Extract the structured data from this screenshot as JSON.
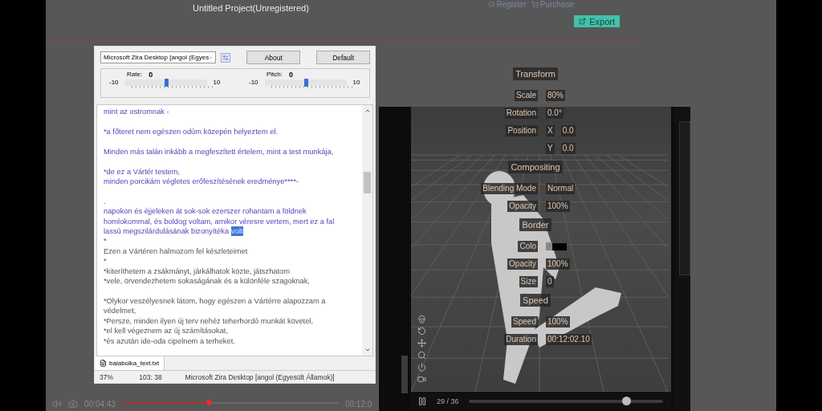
{
  "header": {
    "title": "Untitled Project(Unregistered)",
    "links": [
      {
        "kind": "register",
        "label": "Register"
      },
      {
        "kind": "purchase",
        "label": "Purchase"
      }
    ],
    "export_button": "Export"
  },
  "tts_window": {
    "voice": "Microsoft Zira Desktop [angol (Egyes",
    "buttons": [
      "About",
      "Default"
    ],
    "sliders": [
      {
        "label": "Rate:",
        "value": "0",
        "min": "-10",
        "max": "10",
        "level": 0.5
      },
      {
        "label": "Pitch:",
        "value": "0",
        "min": "-10",
        "max": "10",
        "level": 0.5
      }
    ],
    "paragraphs": [
      {
        "lines": [
          {
            "text": "mint az ostromnak -",
            "read": true
          }
        ]
      },
      {
        "lines": [
          {
            "text": "*a főteret nem egészen odúm közepén helyeztem el.",
            "read": true
          }
        ]
      },
      {
        "lines": [
          {
            "text": "Minden más talán inkább a megfeszített értelem, mint a test munkája,",
            "read": true
          }
        ]
      },
      {
        "lines": [
          {
            "text": "*de ez a Vártér testem,",
            "read": true
          },
          {
            "text": "minden porcikám végletes erőfeszítésének eredménye****-",
            "read": true
          }
        ]
      },
      {
        "lines": [
          {
            "text": "."
          },
          {
            "text": "napokon és éjjeleken át sok-sok ezerszer rohantam a földnek",
            "read": true
          },
          {
            "text": "homlokommal, és boldog voltam, amikor véresre vertem, mert ez a fal",
            "read": true
          },
          {
            "text": "lassú megszilárdulásának bizonyítéka",
            "selection": "volt",
            "read": true
          },
          {
            "text": "*",
            "read": false
          },
          {
            "text": "Ezen a Vártéren halmozom fel készleteimet",
            "read": false
          },
          {
            "text": "*",
            "read": false
          },
          {
            "text": "*kiteríthetem a zsákmányt, járkálhatok közte, játszhatom",
            "read": false
          },
          {
            "text": "*vele, örvendezhetem sokaságának és a különféle szagoknak,",
            "read": false
          }
        ]
      },
      {
        "lines": [
          {
            "text": "*Olykor veszélyesnek látom, hogy egészen a Vártérre alapozzam a",
            "read": false
          },
          {
            "text": "védelmet,",
            "read": false
          },
          {
            "text": "*Persze, minden ilyen új terv nehéz teherhordó munkát követel,",
            "read": false
          },
          {
            "text": "*el kell végeznem az új számításokat,",
            "read": false
          },
          {
            "text": "*és azután ide-oda cipelnem a terheket.",
            "read": false
          }
        ]
      }
    ],
    "file_tab": "balabolka_text.txt",
    "status": [
      "37%",
      "103: 38",
      "Microsoft Zira Desktop [angol (Egyesült Államok)]"
    ]
  },
  "properties": [
    {
      "kind": "heading",
      "label": "Transform"
    },
    {
      "kind": "row",
      "label": "Scale",
      "value": "80%"
    },
    {
      "kind": "row",
      "label": "Rotation",
      "value": "0.0°"
    },
    {
      "kind": "row",
      "label": "Position",
      "axis": "X",
      "value": "0.0"
    },
    {
      "kind": "row",
      "axis": "Y",
      "value": "0.0"
    },
    {
      "kind": "heading",
      "label": "Compositing"
    },
    {
      "kind": "row",
      "label": "Blending Mode",
      "value": "Normal"
    },
    {
      "kind": "row",
      "label": "Opacity",
      "value": "100%"
    },
    {
      "kind": "heading",
      "label": "Border"
    },
    {
      "kind": "swatch",
      "label": "Colo"
    },
    {
      "kind": "row",
      "label": "Opacity",
      "value": "100%"
    },
    {
      "kind": "row",
      "label": "Size",
      "value": "0"
    },
    {
      "kind": "heading",
      "label": "Speed"
    },
    {
      "kind": "row",
      "label": "Speed",
      "value": "100%"
    },
    {
      "kind": "row",
      "label": "Duration",
      "value": "00:12:02.10"
    }
  ],
  "viewer": {
    "frame": "29 / 36",
    "level": 0.81
  },
  "player": {
    "time": "00:04:43",
    "level": 0.4,
    "duration": "00:12:0"
  }
}
